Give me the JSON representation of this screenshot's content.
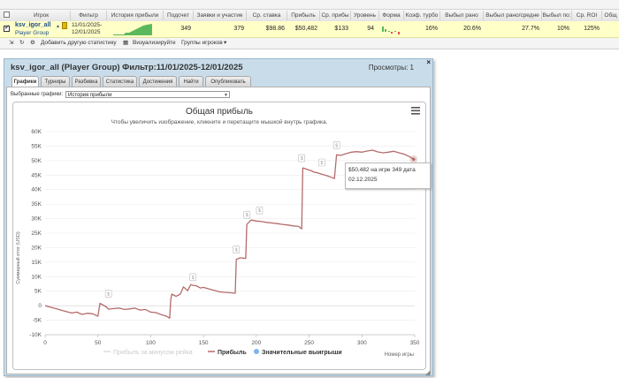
{
  "grid": {
    "headers": [
      "Игрок",
      "Фильтр",
      "История прибыли",
      "Подсчет",
      "Заявки и участие",
      "Ср. ставка",
      "Прибыль",
      "Ср. прибы",
      "Уровень",
      "Форма",
      "Коэф. турбо",
      "Выбыл рано",
      "Выбыл рано/средне",
      "Выбыл по:",
      "Ср. ROI",
      "Общ"
    ],
    "row": {
      "player": "ksv_igor_all",
      "group": "Player Group",
      "filter_line1": "11/01/2025-",
      "filter_line2": "12/01/2025",
      "count": "349",
      "entries": "379",
      "avg_stake": "$98.86",
      "profit": "$50,482",
      "avg_profit": "$133",
      "level": "94",
      "turbo": "16%",
      "early": "20.6%",
      "early_mid": "27.7%",
      "late": "10%",
      "roi": "125%"
    },
    "toolbar": {
      "add_stat": "Добавить другую статистику",
      "visualize": "Визуализируйте",
      "player_groups": "Группы игроков"
    }
  },
  "dialog": {
    "title": "ksv_igor_all (Player Group) Фильтр:11/01/2025-12/01/2025",
    "views": "Просмотры: 1",
    "close": "×",
    "tabs": [
      "Графики",
      "Турниры",
      "Разбивка",
      "Статистика",
      "Достижения",
      "Найти",
      "Опубликовать"
    ],
    "selected_label": "Выбранные графики:",
    "selected_value": "История прибыли"
  },
  "chart_data": {
    "type": "line",
    "title": "Общая прибыль",
    "subtitle": "Чтобы увеличить изображение, кликните и перетащите мышкой внутрь графика.",
    "xlabel": "Номер игры",
    "ylabel": "Суммарный итог (USD)",
    "xlim": [
      0,
      350
    ],
    "ylim": [
      -10000,
      60000
    ],
    "x_ticks": [
      0,
      50,
      100,
      150,
      200,
      250,
      300,
      350
    ],
    "y_ticks": [
      -10000,
      -5000,
      0,
      5000,
      10000,
      15000,
      20000,
      25000,
      30000,
      35000,
      40000,
      45000,
      50000,
      55000,
      60000
    ],
    "y_tick_labels": [
      "-10K",
      "-5K",
      "0",
      "5K",
      "10K",
      "15K",
      "20K",
      "25K",
      "30K",
      "35K",
      "40K",
      "45K",
      "50K",
      "55K",
      "60K"
    ],
    "legend": {
      "position": "bottom",
      "items": [
        "Прибыль за минусом рейка",
        "Прибыль",
        "Значительные выигрыши"
      ]
    },
    "series": [
      {
        "name": "Прибыль",
        "color": "#b56b6b",
        "x": [
          0,
          5,
          10,
          15,
          20,
          25,
          30,
          35,
          40,
          45,
          50,
          52,
          55,
          58,
          60,
          65,
          70,
          75,
          80,
          85,
          90,
          95,
          100,
          105,
          110,
          115,
          118,
          119,
          120,
          124,
          128,
          131,
          135,
          138,
          140,
          143,
          147,
          150,
          155,
          160,
          165,
          170,
          175,
          180,
          181,
          185,
          190,
          191,
          195,
          200,
          205,
          210,
          215,
          220,
          225,
          230,
          235,
          240,
          243,
          244,
          248,
          252,
          255,
          258,
          262,
          265,
          270,
          274,
          276,
          280,
          285,
          290,
          295,
          300,
          305,
          310,
          315,
          320,
          325,
          330,
          335,
          340,
          345,
          349
        ],
        "y": [
          0,
          -500,
          -1000,
          -1500,
          -2000,
          -2500,
          -2200,
          -3000,
          -2600,
          -2800,
          -3600,
          800,
          200,
          -400,
          -1200,
          -1000,
          -800,
          -1300,
          -1100,
          -800,
          -1500,
          -1300,
          -2200,
          -2400,
          -3100,
          -3600,
          -4300,
          2100,
          4000,
          3200,
          4000,
          6500,
          5200,
          7300,
          7000,
          6900,
          6100,
          6300,
          5800,
          5300,
          4800,
          4600,
          4500,
          4300,
          16000,
          16500,
          16300,
          28000,
          29500,
          29200,
          29000,
          28700,
          28500,
          28300,
          28000,
          27800,
          27500,
          27300,
          26500,
          47500,
          47000,
          46500,
          46000,
          45800,
          45300,
          45000,
          44400,
          43800,
          52000,
          51800,
          52400,
          52900,
          53100,
          52900,
          53300,
          53600,
          53000,
          52700,
          52900,
          53200,
          52700,
          52200,
          51400,
          50482
        ]
      },
      {
        "name": "Значительные выигрыши",
        "color": "#7cb5ec",
        "x": [
          60,
          140,
          181,
          191,
          203,
          243,
          262,
          276
        ],
        "y": [
          800,
          6500,
          16000,
          28000,
          29500,
          47500,
          46000,
          52000
        ]
      }
    ],
    "tooltip": {
      "line1": "$50,482 на игре 349 дата",
      "line2": "02.12.2025"
    }
  }
}
